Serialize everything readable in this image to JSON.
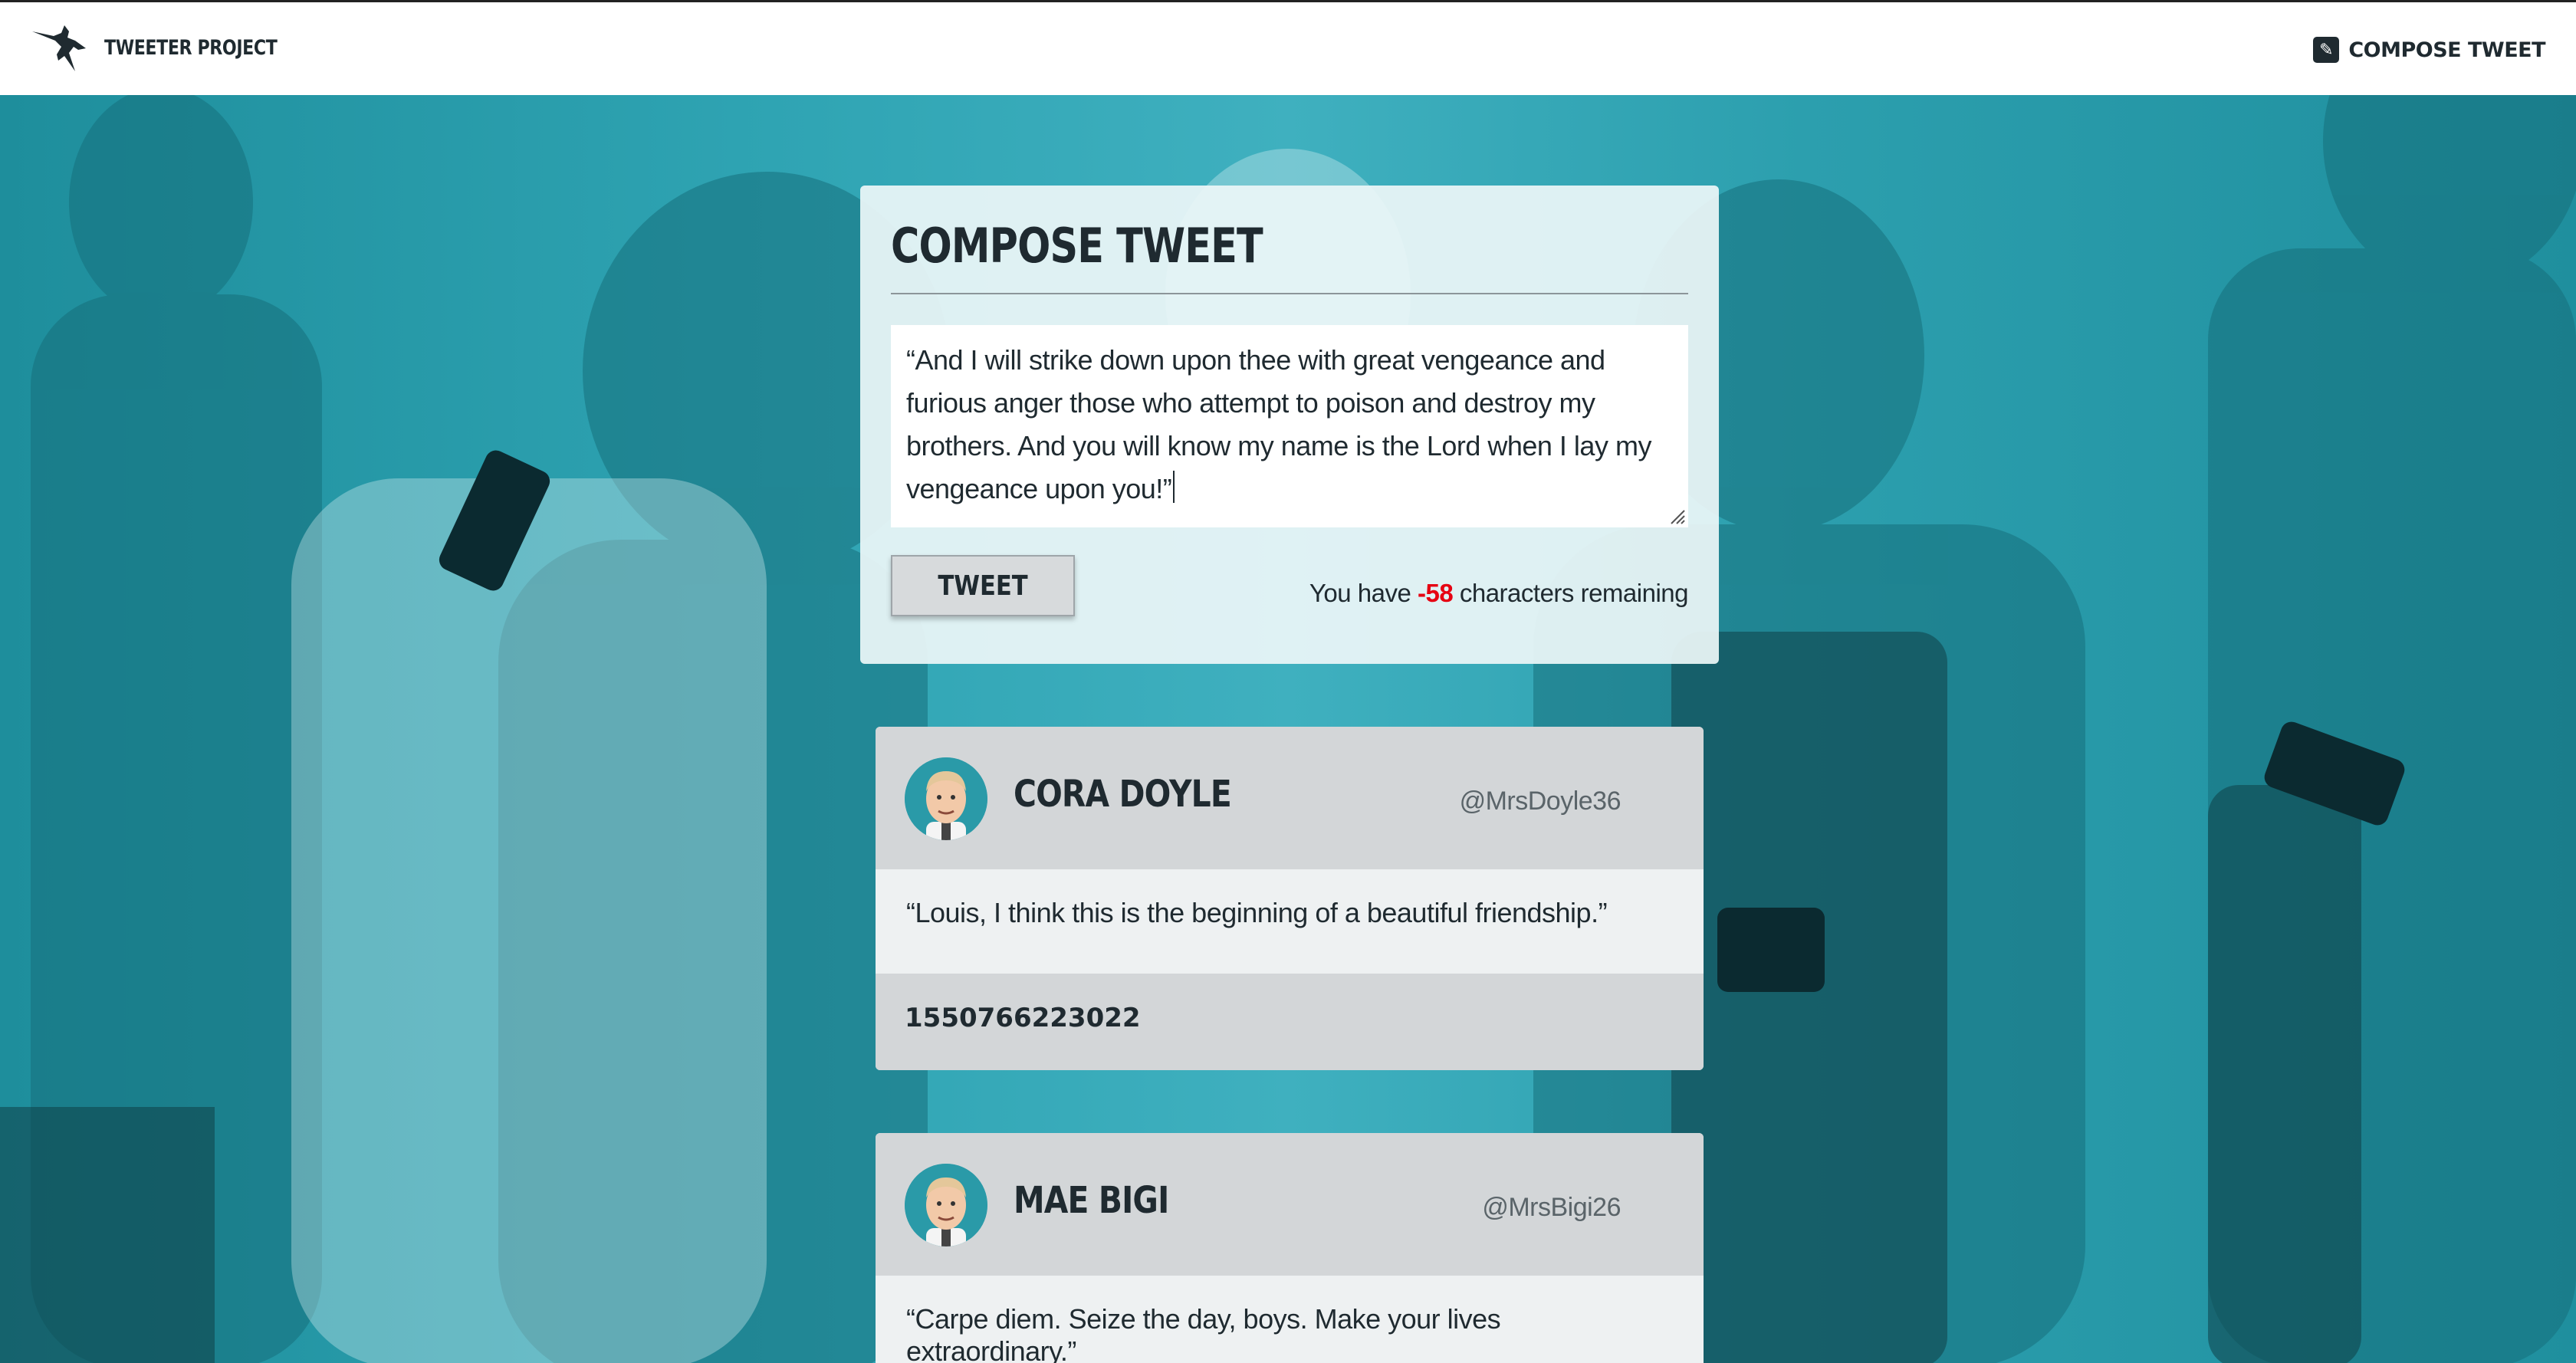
{
  "nav": {
    "brand_label": "TWEETER PROJECT",
    "brand_icon": "hummingbird-icon",
    "compose_label": "COMPOSE TWEET",
    "compose_icon": "pencil-icon"
  },
  "compose": {
    "title": "COMPOSE TWEET",
    "text": "“And I will strike down upon thee with great vengeance and furious anger those who attempt to poison and destroy my brothers. And you will know my name is the Lord when I lay my vengeance upon you!”",
    "button_label": "TWEET",
    "counter_prefix": "You have ",
    "counter_value": "-58",
    "counter_suffix": " characters remaining",
    "counter_color": "#e60012"
  },
  "tweets": [
    {
      "name": "CORA DOYLE",
      "handle": "@MrsDoyle36",
      "content": "“Louis, I think this is the beginning of a beautiful friendship.”",
      "timestamp": "1550766223022",
      "avatar_icon": "avatar-icon"
    },
    {
      "name": "MAE BIGI",
      "handle": "@MrsBigi26",
      "content": "“Carpe diem. Seize the day, boys. Make your lives extraordinary.”",
      "timestamp": "",
      "avatar_icon": "avatar-icon"
    }
  ],
  "colors": {
    "background_teal": "#2a9aa8",
    "dark_text": "#1f2a30",
    "counter_negative": "#e60012"
  }
}
